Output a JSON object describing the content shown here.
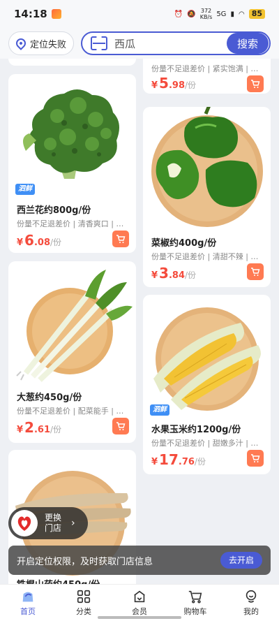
{
  "status_bar": {
    "time": "14:18",
    "net_speed_value": "372",
    "net_speed_unit": "KB/s",
    "network": "5G",
    "battery": "85"
  },
  "header": {
    "location_label": "定位失败",
    "search_value": "西瓜",
    "search_button": "搜索"
  },
  "top_partial": {
    "desc": "份量不足退差价 | 紧实饱满 | 质...",
    "price_int": "5",
    "price_dec": ".98",
    "unit": "/份",
    "currency": "¥"
  },
  "products": [
    {
      "title": "西兰花约800g/份",
      "desc": "份量不足退差价 | 清香爽口 | 低...",
      "currency": "¥",
      "price_int": "6",
      "price_dec": ".08",
      "unit": "/份",
      "badge": "泗鲜"
    },
    {
      "title": "菜椒约400g/份",
      "desc": "份量不足退差价 | 清甜不辣 | 配...",
      "currency": "¥",
      "price_int": "3",
      "price_dec": ".84",
      "unit": "/份",
      "badge": ""
    },
    {
      "title": "大葱约450g/份",
      "desc": "份量不足退差价 | 配菜能手 | 去...",
      "currency": "¥",
      "price_int": "2",
      "price_dec": ".61",
      "unit": "/份",
      "badge": ""
    },
    {
      "title": "水果玉米约1200g/份",
      "desc": "份量不足退差价 | 甜嫩多汁 | 轻...",
      "currency": "¥",
      "price_int": "17",
      "price_dec": ".76",
      "unit": "/份",
      "badge": "泗鲜"
    },
    {
      "title": "铁棍山药约450g/份",
      "desc": "",
      "currency": "¥",
      "price_int": "",
      "price_dec": "",
      "unit": "",
      "badge": ""
    }
  ],
  "store_switch": {
    "label": "更换门店"
  },
  "banner": {
    "message": "开启定位权限，及时获取门店信息",
    "action": "去开启"
  },
  "nav": [
    {
      "label": "首页",
      "icon": "home-icon",
      "active": true
    },
    {
      "label": "分类",
      "icon": "category-icon",
      "active": false
    },
    {
      "label": "会员",
      "icon": "member-icon",
      "active": false
    },
    {
      "label": "购物车",
      "icon": "cart-icon",
      "active": false
    },
    {
      "label": "我的",
      "icon": "profile-icon",
      "active": false
    }
  ],
  "colors": {
    "accent": "#4a5bd4",
    "price": "#f44b3c",
    "cart_button": "#ff7a52",
    "badge": "#3f8ff5"
  }
}
